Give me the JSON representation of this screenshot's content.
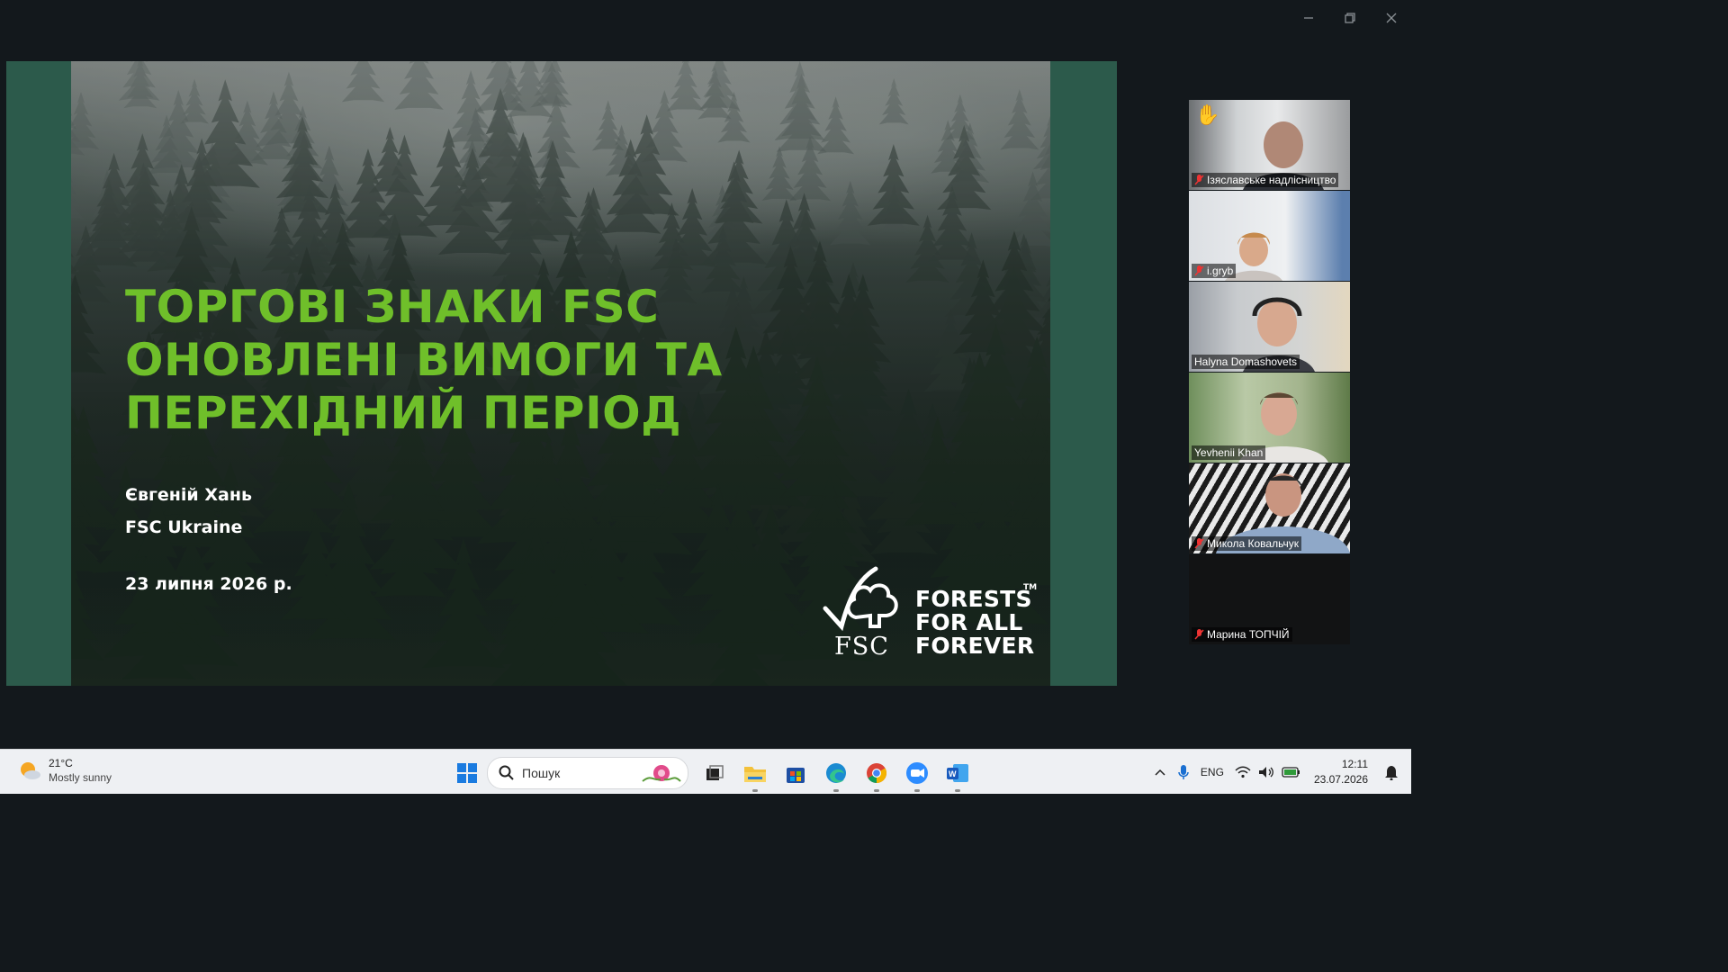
{
  "window": {
    "controls": {
      "minimize_icon": "minimize-icon",
      "restore_icon": "restore-icon",
      "close_icon": "close-icon"
    }
  },
  "slide": {
    "title": "ТОРГОВІ ЗНАКИ FSC ОНОВЛЕНІ ВИМОГИ ТА ПЕРЕХІДНИЙ ПЕРІОД",
    "presenter": "Євгеній Хань",
    "organization": "FSC Ukraine",
    "date": "23 липня 2026 р.",
    "logo_text": "FSC",
    "slogan_line1": "FORESTS",
    "slogan_line2": "FOR ALL",
    "slogan_line3": "FOREVER",
    "trademark": "TM",
    "colors": {
      "title": "#6fbf2a",
      "frame": "#2c5a4b"
    }
  },
  "participants": [
    {
      "name": "Ізяславське надлісництво",
      "muted": true,
      "hand_raised": true
    },
    {
      "name": "i.gryb",
      "muted": true
    },
    {
      "name": "Halyna Domashovets",
      "muted": false
    },
    {
      "name": "Yevhenii Khan",
      "muted": false,
      "active_speaker": true
    },
    {
      "name": "Микола Ковальчук",
      "muted": true
    },
    {
      "name": "Марина ТОПЧІЙ",
      "muted": true,
      "video_off": true
    }
  ],
  "taskbar": {
    "weather": {
      "temp": "21°C",
      "condition": "Mostly sunny"
    },
    "search_placeholder": "Пошук",
    "apps": [
      "start-icon",
      "task-view-icon",
      "file-explorer-icon",
      "microsoft-store-icon",
      "edge-icon",
      "chrome-icon",
      "zoom-icon",
      "word-icon"
    ],
    "tray": {
      "language": "ENG",
      "time": "12:11",
      "date": "23.07.2026"
    }
  }
}
